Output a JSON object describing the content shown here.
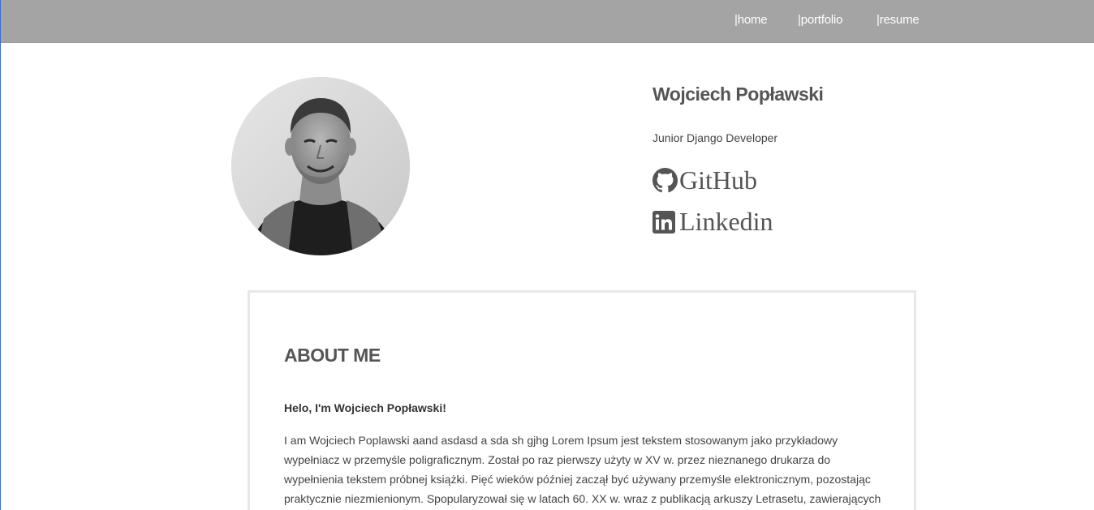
{
  "nav": {
    "items": [
      {
        "label": "|home"
      },
      {
        "label": "|portfolio"
      },
      {
        "label": "|resume"
      }
    ]
  },
  "profile": {
    "name": "Wojciech Popławski",
    "role": "Junior Django Developer",
    "photo_icon": "profile-photo",
    "links": [
      {
        "label": "GitHub",
        "icon": "github-icon"
      },
      {
        "label": "Linkedin",
        "icon": "linkedin-icon"
      }
    ]
  },
  "about": {
    "title": "ABOUT ME",
    "greeting": "Helo, I'm Wojciech Popławski!",
    "text": "I am Wojciech Poplawski aand asdasd a sda sh gjhg Lorem Ipsum jest tekstem stosowanym jako przykładowy wypełniacz w przemyśle poligraficznym. Został po raz pierwszy użyty w XV w. przez nieznanego drukarza do wypełnienia tekstem próbnej książki. Pięć wieków później zaczął być używany przemyśle elektronicznym, pozostając praktycznie niezmienionym. Spopularyzował się w latach 60. XX w. wraz z publikacją arkuszy Letrasetu, zawierających fragmenty Lorem Ipsum, a"
  },
  "colors": {
    "navbar": "#a4a4a4",
    "text": "#555555",
    "card_border": "#e8e8e8"
  }
}
